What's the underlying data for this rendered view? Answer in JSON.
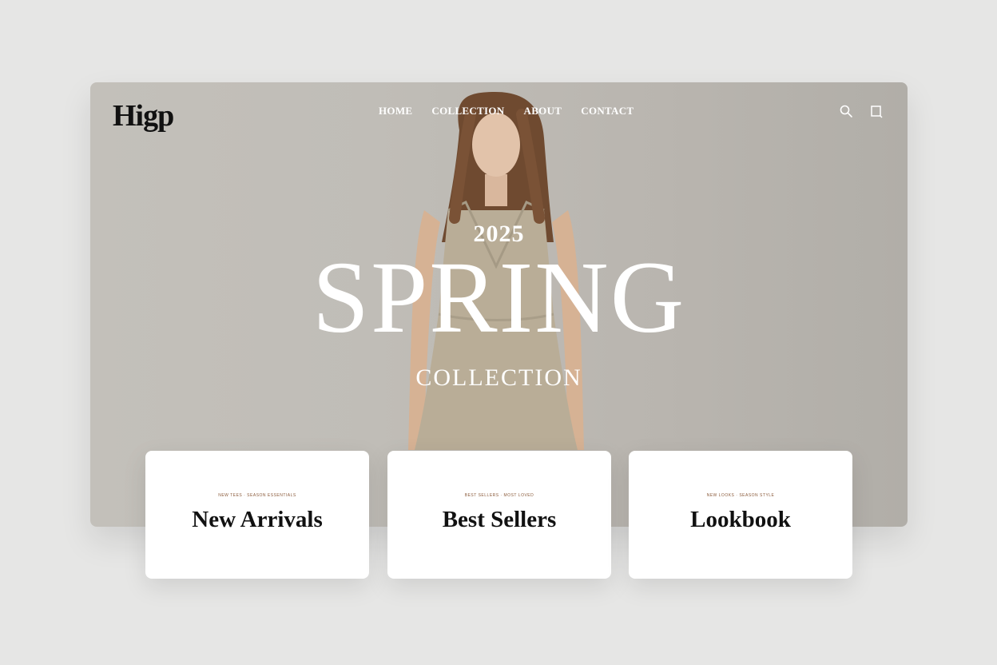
{
  "brand": {
    "logo_text": "Higp"
  },
  "nav": {
    "items": [
      "HOME",
      "COLLECTION",
      "ABOUT",
      "CONTACT"
    ]
  },
  "icons": {
    "search": "search-icon",
    "bag": "shopping-bag-icon"
  },
  "hero": {
    "year": "2025",
    "headline": "SPRING",
    "subline": "COLLECTION"
  },
  "cards": [
    {
      "kicker": "NEW TEES · SEASON ESSENTIALS",
      "title": "New Arrivals"
    },
    {
      "kicker": "BEST SELLERS · MOST LOVED",
      "title": "Best Sellers"
    },
    {
      "kicker": "NEW LOOKS · SEASON STYLE",
      "title": "Lookbook"
    }
  ],
  "colors": {
    "hero_bg": "#c0bdb7",
    "page_bg": "#e6e6e5",
    "dress": "#b8ab95",
    "hair": "#7a5236"
  }
}
